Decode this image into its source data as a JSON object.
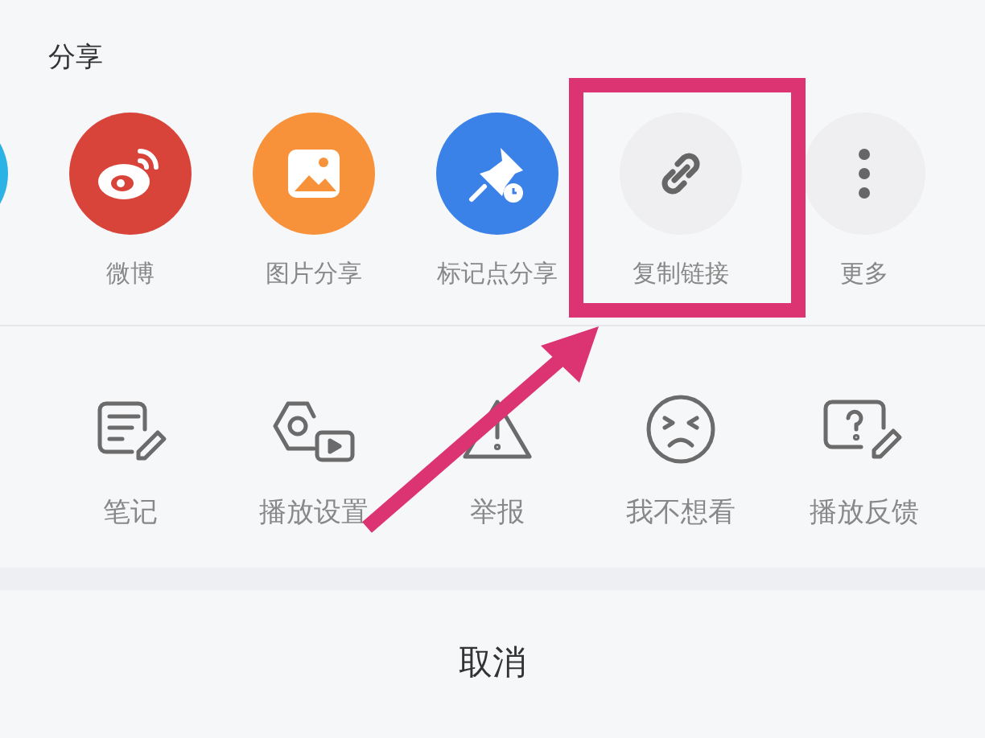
{
  "share": {
    "title": "分享",
    "items": [
      {
        "kind": "partial"
      },
      {
        "kind": "weibo",
        "label": "微博"
      },
      {
        "kind": "image",
        "label": "图片分享"
      },
      {
        "kind": "pin",
        "label": "标记点分享"
      },
      {
        "kind": "link",
        "label": "复制链接"
      },
      {
        "kind": "more",
        "label": "更多"
      }
    ]
  },
  "actions": [
    {
      "kind": "note",
      "label": "笔记"
    },
    {
      "kind": "play-settings",
      "label": "播放设置"
    },
    {
      "kind": "report",
      "label": "举报"
    },
    {
      "kind": "dislike",
      "label": "我不想看"
    },
    {
      "kind": "feedback",
      "label": "播放反馈"
    }
  ],
  "cancel": "取消"
}
